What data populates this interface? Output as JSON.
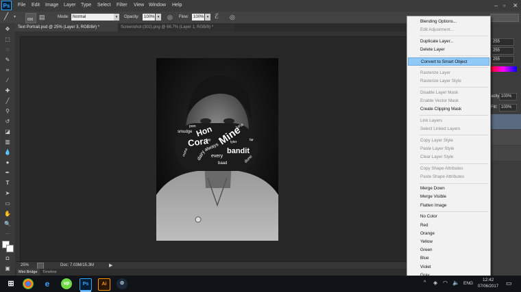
{
  "app": {
    "logo": "Ps"
  },
  "menubar": {
    "items": [
      "File",
      "Edit",
      "Image",
      "Layer",
      "Type",
      "Select",
      "Filter",
      "View",
      "Window",
      "Help"
    ]
  },
  "options": {
    "brush_size": "600",
    "mode_label": "Mode:",
    "mode_value": "Normal",
    "opacity_label": "Opacity:",
    "opacity_value": "100%",
    "flow_label": "Flow:",
    "flow_value": "100%"
  },
  "tabs": [
    {
      "label": "Text Portrait.psd @ 25% (Layer 3, RGB/8#) *",
      "active": true
    },
    {
      "label": "Screenshot (302).png @ 66.7% (Layer 1, RGB/8) *",
      "active": false
    }
  ],
  "status": {
    "zoom": "25%",
    "doc": "Doc: 7.03M/15.3M"
  },
  "bottom_tabs": [
    "Mini Bridge",
    "Timeline"
  ],
  "panels": {
    "values": [
      "255",
      "255",
      "255"
    ],
    "opacity_label": "acity:",
    "opacity_value": "100%",
    "fill_label": "Fill:",
    "fill_value": "100%"
  },
  "context_menu": {
    "items": [
      {
        "label": "Blending Options...",
        "disabled": false
      },
      {
        "label": "Edit Adjustment...",
        "disabled": true
      },
      {
        "sep": true
      },
      {
        "label": "Duplicate Layer...",
        "disabled": false
      },
      {
        "label": "Delete Layer",
        "disabled": false
      },
      {
        "sep": true
      },
      {
        "label": "Convert to Smart Object",
        "disabled": false,
        "highlighted": true
      },
      {
        "sep": true
      },
      {
        "label": "Rasterize Layer",
        "disabled": true
      },
      {
        "label": "Rasterize Layer Style",
        "disabled": true
      },
      {
        "sep": true
      },
      {
        "label": "Disable Layer Mask",
        "disabled": true
      },
      {
        "label": "Enable Vector Mask",
        "disabled": true
      },
      {
        "label": "Create Clipping Mask",
        "disabled": false
      },
      {
        "sep": true
      },
      {
        "label": "Link Layers",
        "disabled": true
      },
      {
        "label": "Select Linked Layers",
        "disabled": true
      },
      {
        "sep": true
      },
      {
        "label": "Copy Layer Style",
        "disabled": true
      },
      {
        "label": "Paste Layer Style",
        "disabled": true
      },
      {
        "label": "Clear Layer Style",
        "disabled": true
      },
      {
        "sep": true
      },
      {
        "label": "Copy Shape Attributes",
        "disabled": true
      },
      {
        "label": "Paste Shape Attributes",
        "disabled": true
      },
      {
        "sep": true
      },
      {
        "label": "Merge Down",
        "disabled": false
      },
      {
        "label": "Merge Visible",
        "disabled": false
      },
      {
        "label": "Flatten Image",
        "disabled": false
      },
      {
        "sep": true
      },
      {
        "label": "No Color",
        "disabled": false
      },
      {
        "label": "Red",
        "disabled": false
      },
      {
        "label": "Orange",
        "disabled": false
      },
      {
        "label": "Yellow",
        "disabled": false
      },
      {
        "label": "Green",
        "disabled": false
      },
      {
        "label": "Blue",
        "disabled": false
      },
      {
        "label": "Violet",
        "disabled": false
      },
      {
        "label": "Gray",
        "disabled": false
      }
    ]
  },
  "word_cloud": [
    "Cora",
    "Hon",
    "Mine",
    "bandit",
    "smudge",
    "every",
    "baad",
    "dairy",
    "always",
    "dune",
    "luna",
    "pom",
    "mona",
    "tyler",
    "lay",
    "far"
  ],
  "taskbar": {
    "apps": [
      "windows",
      "chrome",
      "edge",
      "upwork",
      "photoshop",
      "illustrator",
      "steam"
    ],
    "photoshop_label": "Ps",
    "illustrator_label": "Ai",
    "upwork_label": "up",
    "lang": "ENG",
    "time": "12:42",
    "date": "07/06/2017"
  },
  "colors": {
    "ps_blue": "#31a8ff",
    "highlight": "#91c9f7",
    "ai_orange": "#ff9a00",
    "upwork_green": "#6fda44"
  }
}
